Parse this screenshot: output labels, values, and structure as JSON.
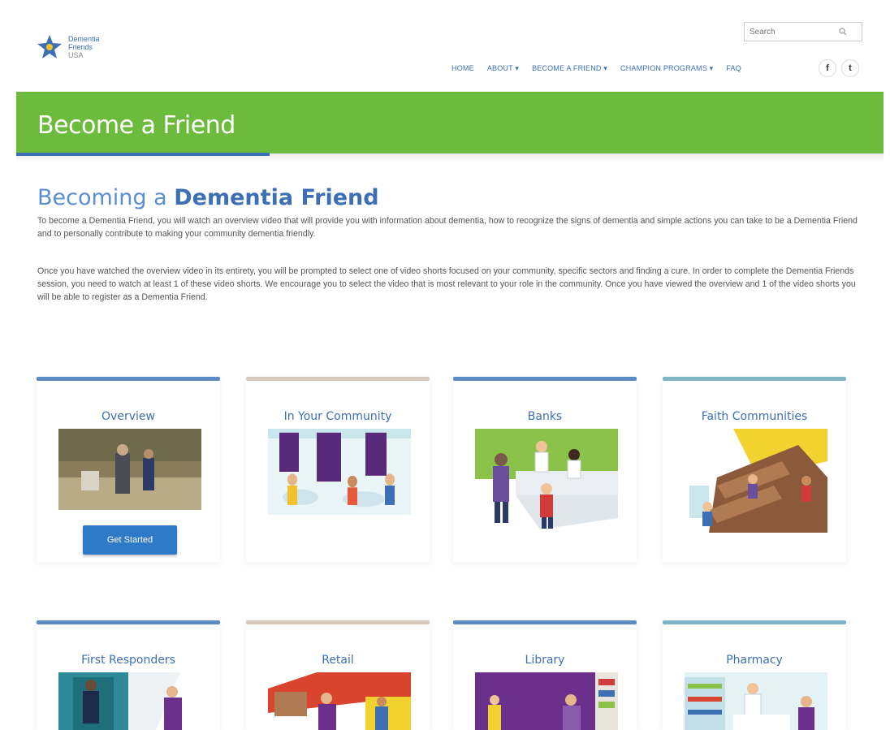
{
  "logo": {
    "line1": "Dementia",
    "line2": "Friends",
    "line3": "USA"
  },
  "search": {
    "placeholder": "Search"
  },
  "nav": {
    "items": [
      "HOME",
      "ABOUT ▾",
      "BECOME A FRIEND ▾",
      "CHAMPION PROGRAMS ▾",
      "FAQ"
    ]
  },
  "social": {
    "facebook": "f",
    "twitter": "t"
  },
  "banner": {
    "title": "Become a Friend"
  },
  "intro": {
    "title_light": "Becoming a ",
    "title_bold": "Dementia Friend",
    "paragraph1": "To become a Dementia Friend, you will watch an overview video that will provide you with information about dementia, how to recognize the signs of dementia and simple actions you can take to be a Dementia Friend and to personally contribute to making your community dementia friendly.",
    "paragraph2": "Once you have watched the overview video in its entirety, you will be prompted to select one of video shorts focused on your community, specific sectors and finding a cure. In order to complete the Dementia Friends session, you need to watch at least 1 of these video shorts. We encourage you to select the video that is most relevant to your role in the community. Once you have viewed the overview and 1 of the video shorts you will be able to register as a Dementia Friend."
  },
  "cards": [
    {
      "title": "Overview",
      "button": "Get Started"
    },
    {
      "title": "In Your Community"
    },
    {
      "title": "Banks"
    },
    {
      "title": "Faith Communities"
    },
    {
      "title": "First Responders"
    },
    {
      "title": "Retail"
    },
    {
      "title": "Library"
    },
    {
      "title": "Pharmacy"
    }
  ],
  "colors": {
    "banner_green": "#6cbb3c",
    "brand_blue": "#3d6fb5",
    "button_blue": "#2e79c8",
    "card_bar_blue": "#5b8ac4",
    "card_bar_tan": "#d8c9bd",
    "card_bar_teal": "#7fb3c6"
  },
  "icons": [
    "star-logo-icon",
    "search-icon",
    "facebook-icon",
    "twitter-icon"
  ]
}
